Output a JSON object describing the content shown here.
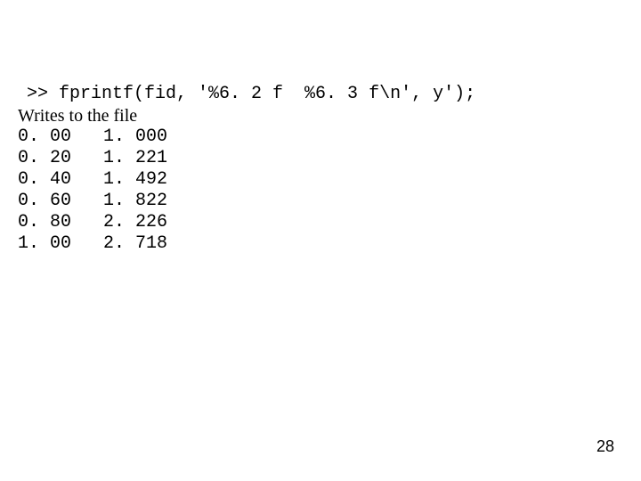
{
  "command_line": ">> fprintf(fid, '%6. 2 f  %6. 3 f\\n', y');",
  "description": "Writes to the file",
  "data_rows": [
    {
      "col1": "0. 00",
      "col2": "1. 000"
    },
    {
      "col1": "0. 20",
      "col2": "1. 221"
    },
    {
      "col1": "0. 40",
      "col2": "1. 492"
    },
    {
      "col1": "0. 60",
      "col2": "1. 822"
    },
    {
      "col1": "0. 80",
      "col2": "2. 226"
    },
    {
      "col1": "1. 00",
      "col2": "2. 718"
    }
  ],
  "page_number": "28"
}
